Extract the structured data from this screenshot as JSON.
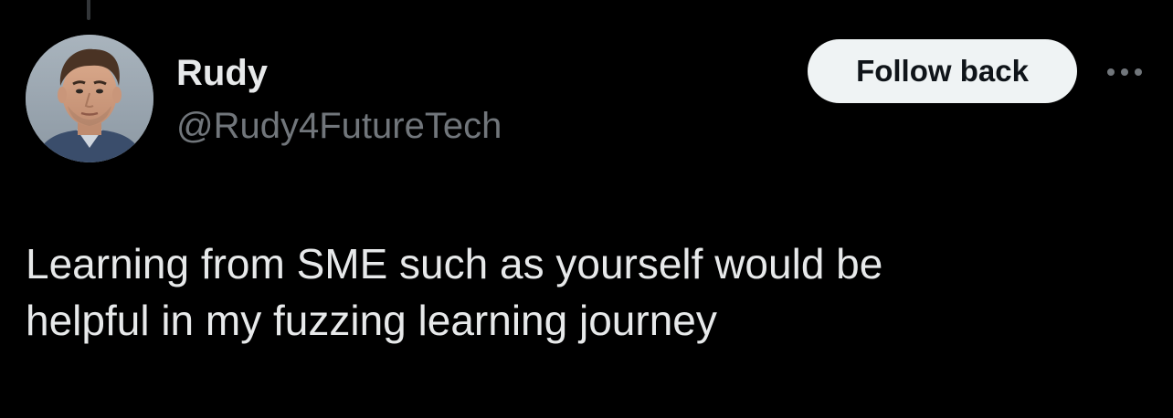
{
  "tweet": {
    "author": {
      "display_name": "Rudy",
      "handle": "@Rudy4FutureTech",
      "avatar": "profile-photo"
    },
    "follow_button_label": "Follow back",
    "more_icon": "more-horizontal-icon",
    "text_lines": [
      "Learning from SME such as yourself would be",
      "helpful in my fuzzing learning journey"
    ]
  },
  "colors": {
    "background": "#000000",
    "primary_text": "#e7e9ea",
    "secondary_text": "#71767b",
    "button_bg": "#eff3f4",
    "button_text": "#0f1419",
    "thread_line": "#333639"
  }
}
